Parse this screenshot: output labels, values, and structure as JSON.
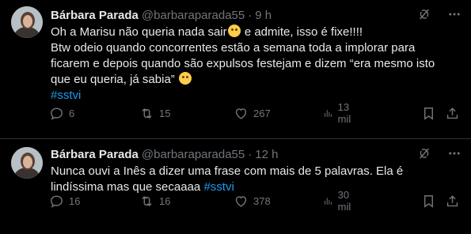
{
  "tweets": [
    {
      "name": "Bárbara Parada",
      "handle": "@barbaraparada55",
      "dot": "·",
      "time": "9 h",
      "lines": [
        "Oh a Marisu não queria nada sair",
        "e admite, isso é fixe!!!!",
        "Btw odeio quando concorrentes estão a semana toda a implorar para",
        "ficarem e depois quando são expulsos festejam e dizem “era mesmo isto",
        "que eu queria, já sabia”"
      ],
      "hashtag": "#sstvi",
      "replies": "6",
      "retweets": "15",
      "likes": "267",
      "views": "13 mil"
    },
    {
      "name": "Bárbara Parada",
      "handle": "@barbaraparada55",
      "dot": "·",
      "time": "12 h",
      "lines": [
        "Nunca ouvi a Inês a dizer uma frase com mais de 5 palavras. Ela é",
        "lindíssima mas que secaaaa"
      ],
      "hashtag": "#sstvi",
      "replies": "16",
      "retweets": "16",
      "likes": "378",
      "views": "30 mil"
    }
  ],
  "colors": {
    "background": "#000000",
    "text": "#e7e9ea",
    "muted": "#71767b",
    "link": "#1d9bf0",
    "divider": "#2f3336"
  },
  "icons": [
    "grok-icon",
    "more-icon",
    "reply-icon",
    "retweet-icon",
    "like-icon",
    "views-icon",
    "bookmark-icon",
    "share-icon"
  ]
}
